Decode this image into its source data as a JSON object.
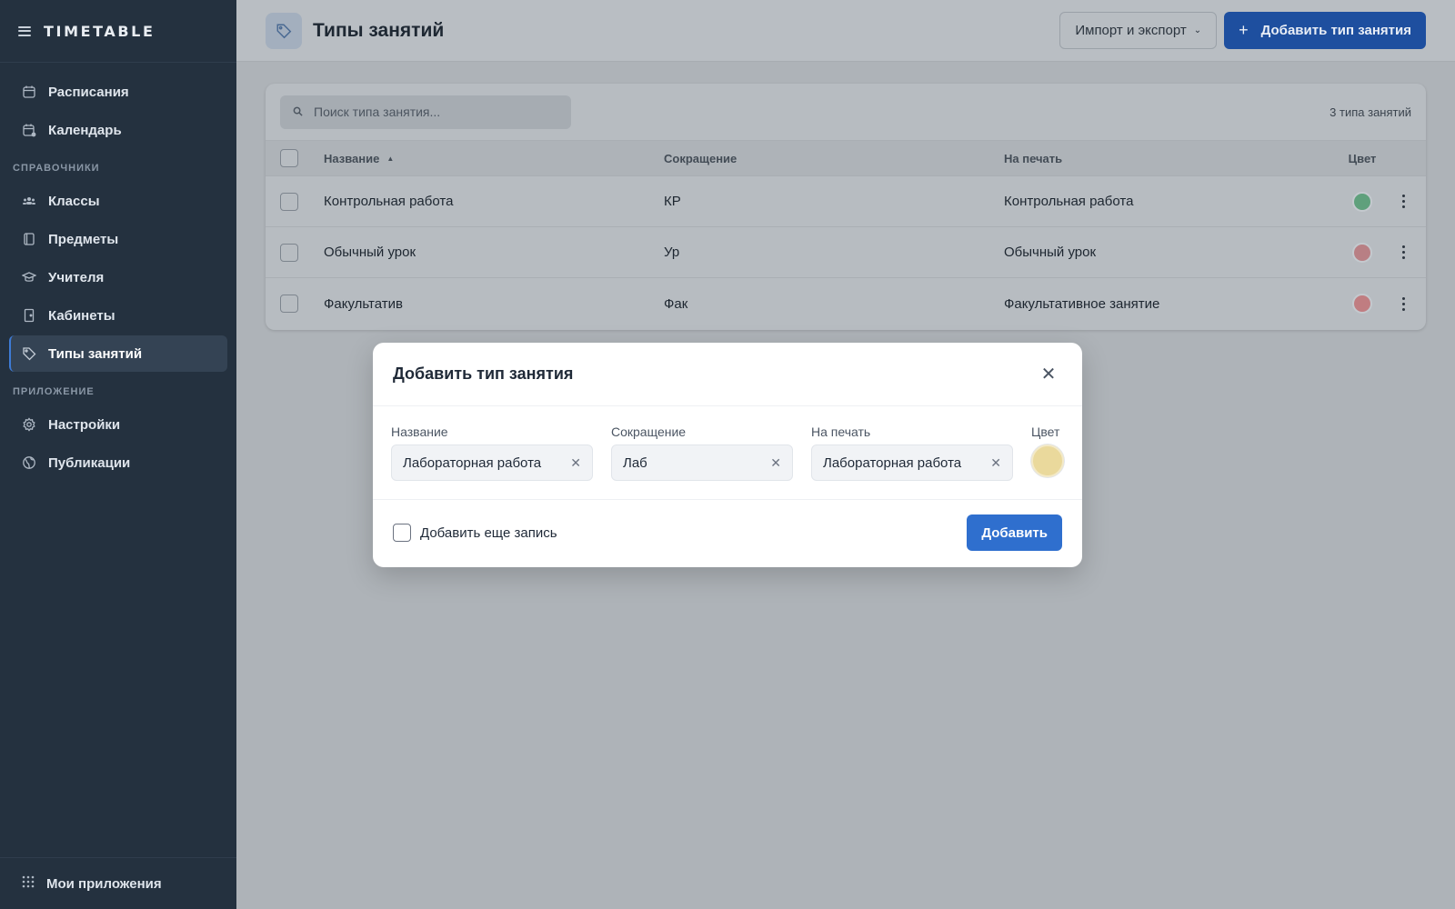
{
  "app": {
    "brand": "TIMETABLE"
  },
  "sidebar": {
    "items_top": [
      {
        "label": "Расписания",
        "icon": "calendar-icon"
      },
      {
        "label": "Календарь",
        "icon": "calendar-clock-icon"
      }
    ],
    "section_refs": "СПРАВОЧНИКИ",
    "items_refs": [
      {
        "label": "Классы",
        "icon": "users-icon"
      },
      {
        "label": "Предметы",
        "icon": "book-icon"
      },
      {
        "label": "Учителя",
        "icon": "graduation-cap-icon"
      },
      {
        "label": "Кабинеты",
        "icon": "door-icon"
      },
      {
        "label": "Типы занятий",
        "icon": "tag-icon",
        "active": true
      }
    ],
    "section_app": "ПРИЛОЖЕНИЕ",
    "items_app": [
      {
        "label": "Настройки",
        "icon": "gear-icon"
      },
      {
        "label": "Публикации",
        "icon": "globe-icon"
      }
    ],
    "footer": {
      "label": "Мои приложения",
      "icon": "grid-icon"
    }
  },
  "header": {
    "title": "Типы занятий",
    "import_export": "Импорт и экспорт",
    "add_button": "Добавить тип занятия"
  },
  "table": {
    "search_placeholder": "Поиск типа занятия...",
    "count": "3 типа занятий",
    "columns": {
      "name": "Название",
      "abbr": "Сокращение",
      "print": "На печать",
      "color": "Цвет"
    },
    "rows": [
      {
        "name": "Контрольная работа",
        "abbr": "КР",
        "print": "Контрольная работа",
        "color": "#5fa07c"
      },
      {
        "name": "Обычный урок",
        "abbr": "Ур",
        "print": "Обычный урок",
        "color": "#b87f84"
      },
      {
        "name": "Факультатив",
        "abbr": "Фак",
        "print": "Факультативное занятие",
        "color": "#c07d81"
      }
    ]
  },
  "modal": {
    "title": "Добавить тип занятия",
    "fields": {
      "name_label": "Название",
      "name_value": "Лабораторная работа",
      "abbr_label": "Сокращение",
      "abbr_value": "Лаб",
      "print_label": "На печать",
      "print_value": "Лабораторная работа",
      "color_label": "Цвет",
      "color_value": "#ead99c"
    },
    "add_another": "Добавить еще запись",
    "submit": "Добавить"
  }
}
